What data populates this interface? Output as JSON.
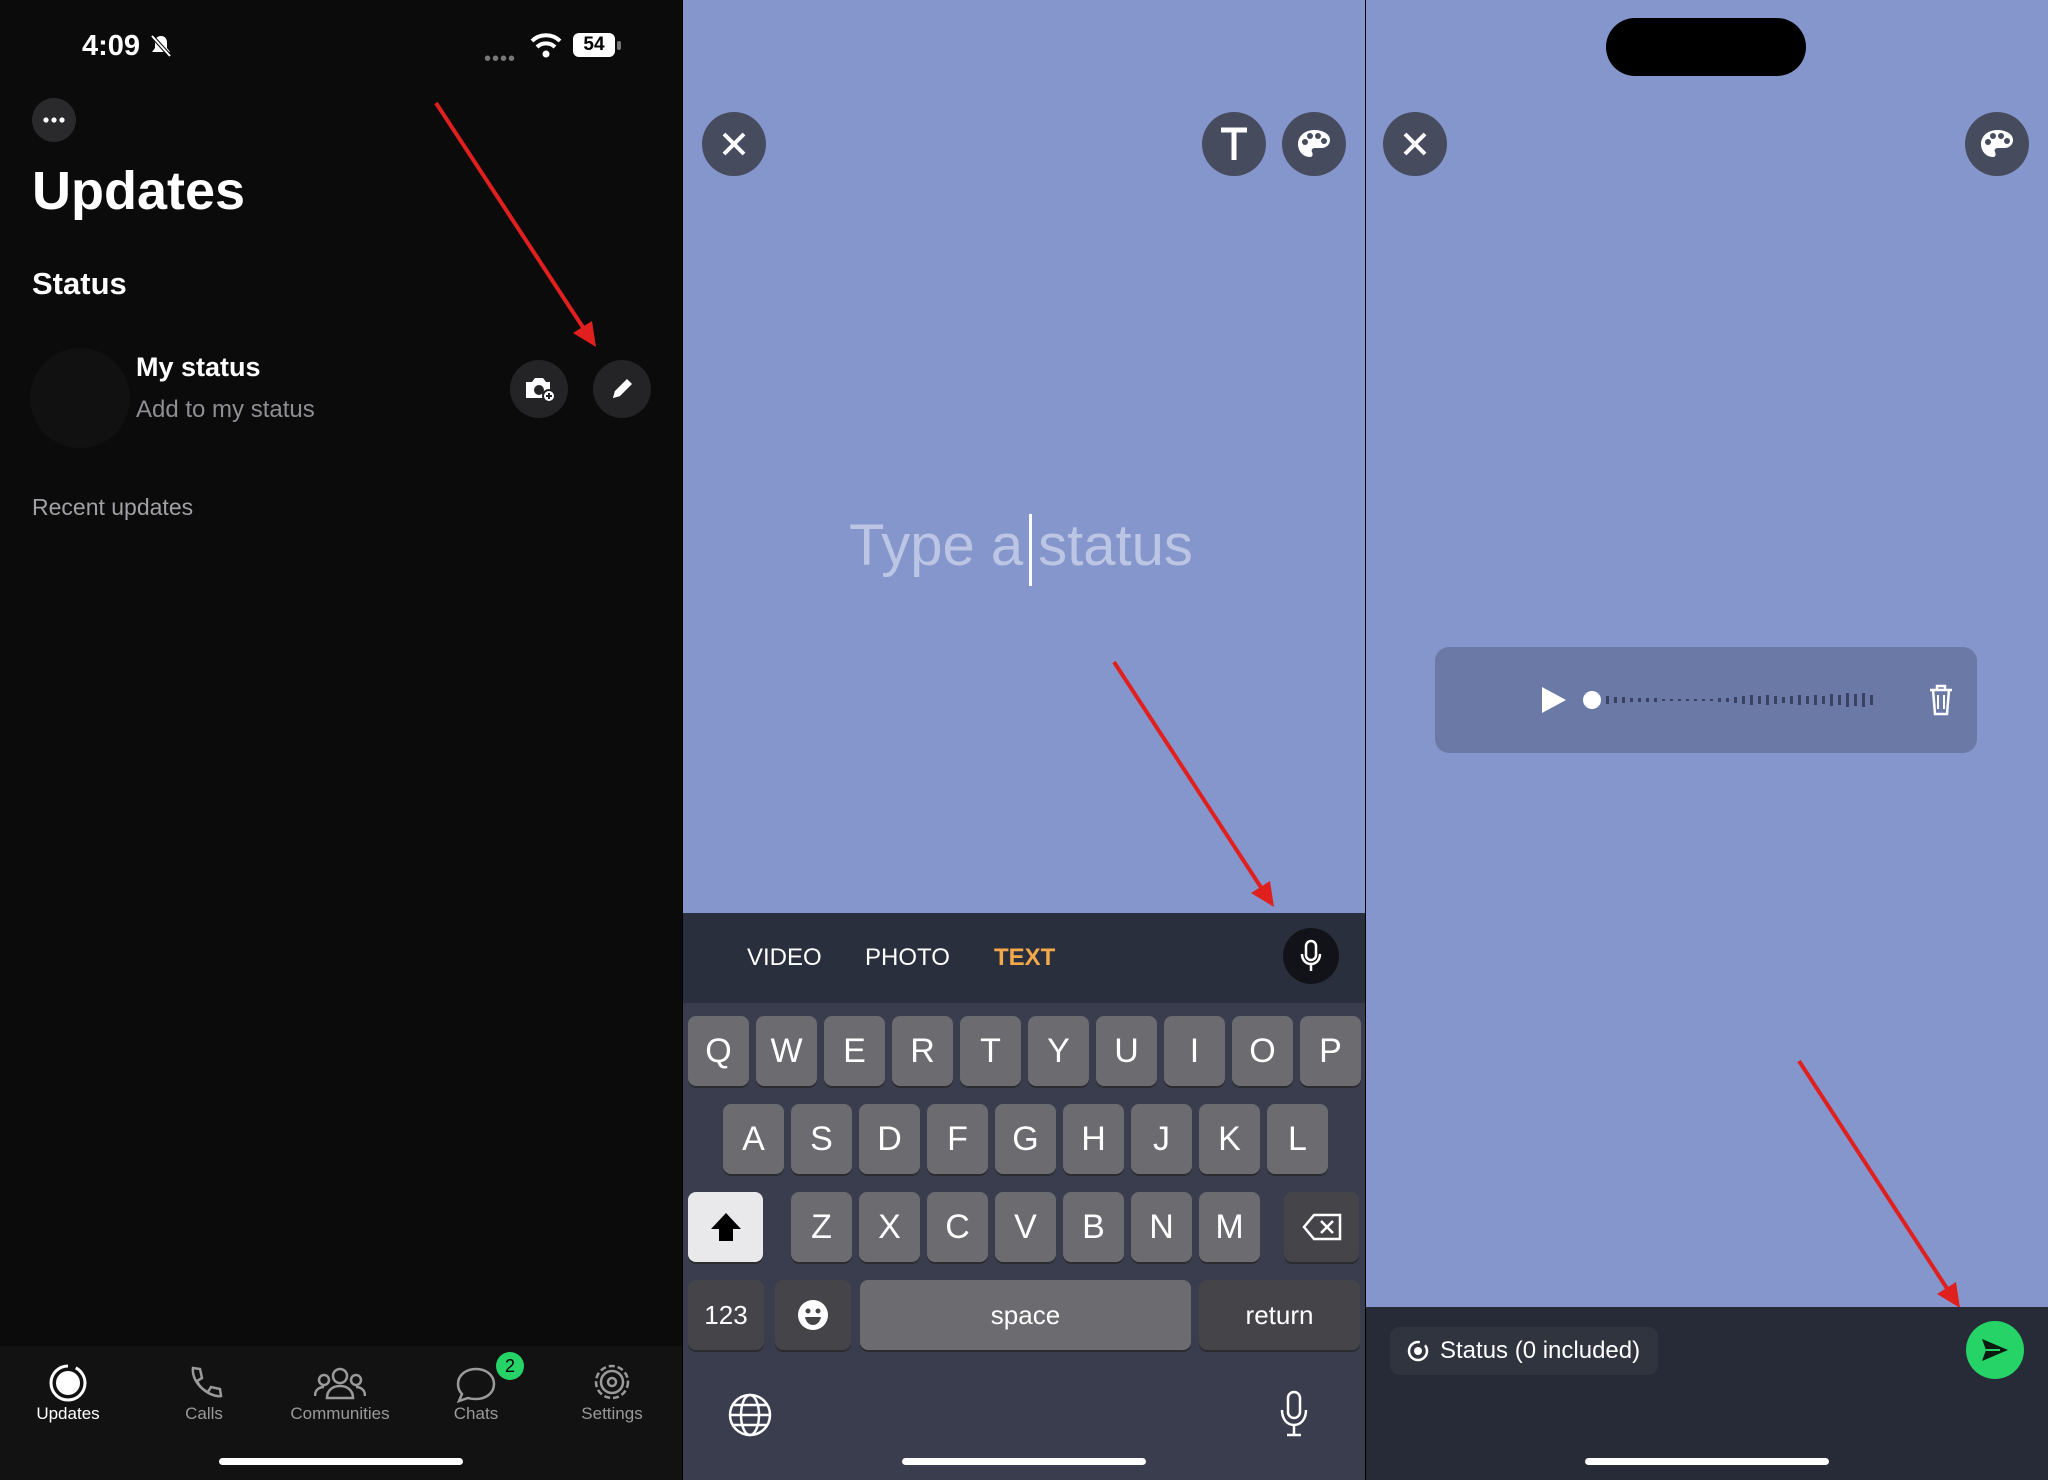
{
  "panel1": {
    "status_bar": {
      "time": "4:09",
      "battery": "54"
    },
    "title": "Updates",
    "section_status": "Status",
    "my_status": {
      "name": "My status",
      "subtitle": "Add to my status"
    },
    "recent_label": "Recent updates",
    "tabs": [
      {
        "label": "Updates",
        "icon": "updates-icon",
        "active": true
      },
      {
        "label": "Calls",
        "icon": "phone-icon"
      },
      {
        "label": "Communities",
        "icon": "communities-icon"
      },
      {
        "label": "Chats",
        "icon": "chats-icon",
        "badge": "2"
      },
      {
        "label": "Settings",
        "icon": "gear-icon"
      }
    ]
  },
  "panel2": {
    "text_placeholder_before": "Type a",
    "text_placeholder_after": "status",
    "modes": [
      "VIDEO",
      "PHOTO",
      "TEXT"
    ],
    "active_mode": "TEXT",
    "keyboard": {
      "row1": [
        "Q",
        "W",
        "E",
        "R",
        "T",
        "Y",
        "U",
        "I",
        "O",
        "P"
      ],
      "row2": [
        "A",
        "S",
        "D",
        "F",
        "G",
        "H",
        "J",
        "K",
        "L"
      ],
      "row3": [
        "Z",
        "X",
        "C",
        "V",
        "B",
        "N",
        "M"
      ],
      "numbers_key": "123",
      "space_key": "space",
      "return_key": "return"
    }
  },
  "panel3": {
    "audience_label": "Status (0 included)"
  },
  "colors": {
    "status_bg": "#8496cb",
    "accent_text": "#f3a84a",
    "send_green": "#25d366",
    "arrow_red": "#e0201f"
  }
}
